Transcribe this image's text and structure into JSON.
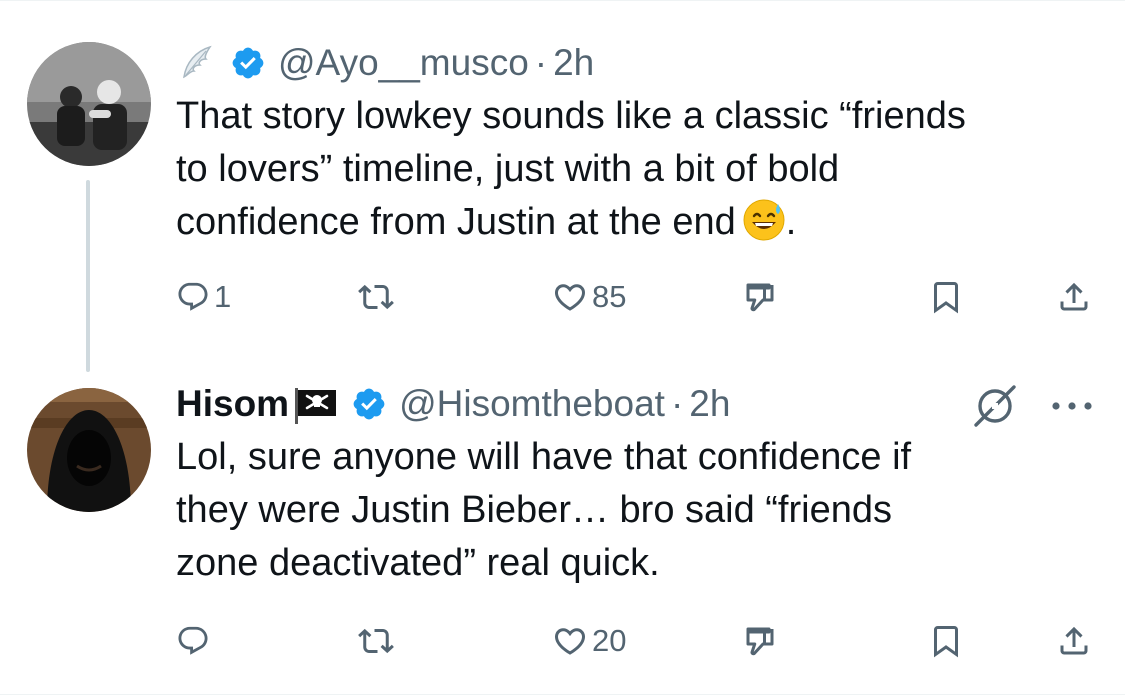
{
  "tweets": [
    {
      "display_name": "",
      "handle": "@Ayo__musco",
      "separator": "·",
      "time": "2h",
      "text": "That story lowkey sounds like a classic “friends to lovers” timeline, just with a bit of bold confidence from Justin at the end",
      "trailing_emoji": "grinning-sweat-emoji",
      "trailing_text": ".",
      "replies": "1",
      "reposts": "",
      "likes": "85",
      "verified": true
    },
    {
      "display_name": "Hisom",
      "name_emoji": "pirate-flag-emoji",
      "handle": "@Hisomtheboat",
      "separator": "·",
      "time": "2h",
      "text_lines": [
        "Lol, sure anyone will have that confidence if",
        "they were Justin Bieber…  bro said “friends",
        "zone deactivated” real quick."
      ],
      "replies": "",
      "reposts": "",
      "likes": "20",
      "verified": true
    }
  ],
  "tweet1_lines": [
    "That story lowkey sounds like a classic “friends",
    "to lovers” timeline, just with a bit of bold",
    "confidence from Justin at the end"
  ],
  "colors": {
    "verified_blue": "#1d9bf0",
    "secondary_text": "#536471",
    "thread_line": "#cfd9de"
  },
  "icons": [
    "reply-icon",
    "repost-icon",
    "like-icon",
    "dislike-icon",
    "bookmark-icon",
    "share-icon",
    "grok-icon",
    "more-icon",
    "verified-badge-icon",
    "wing-emoji"
  ]
}
